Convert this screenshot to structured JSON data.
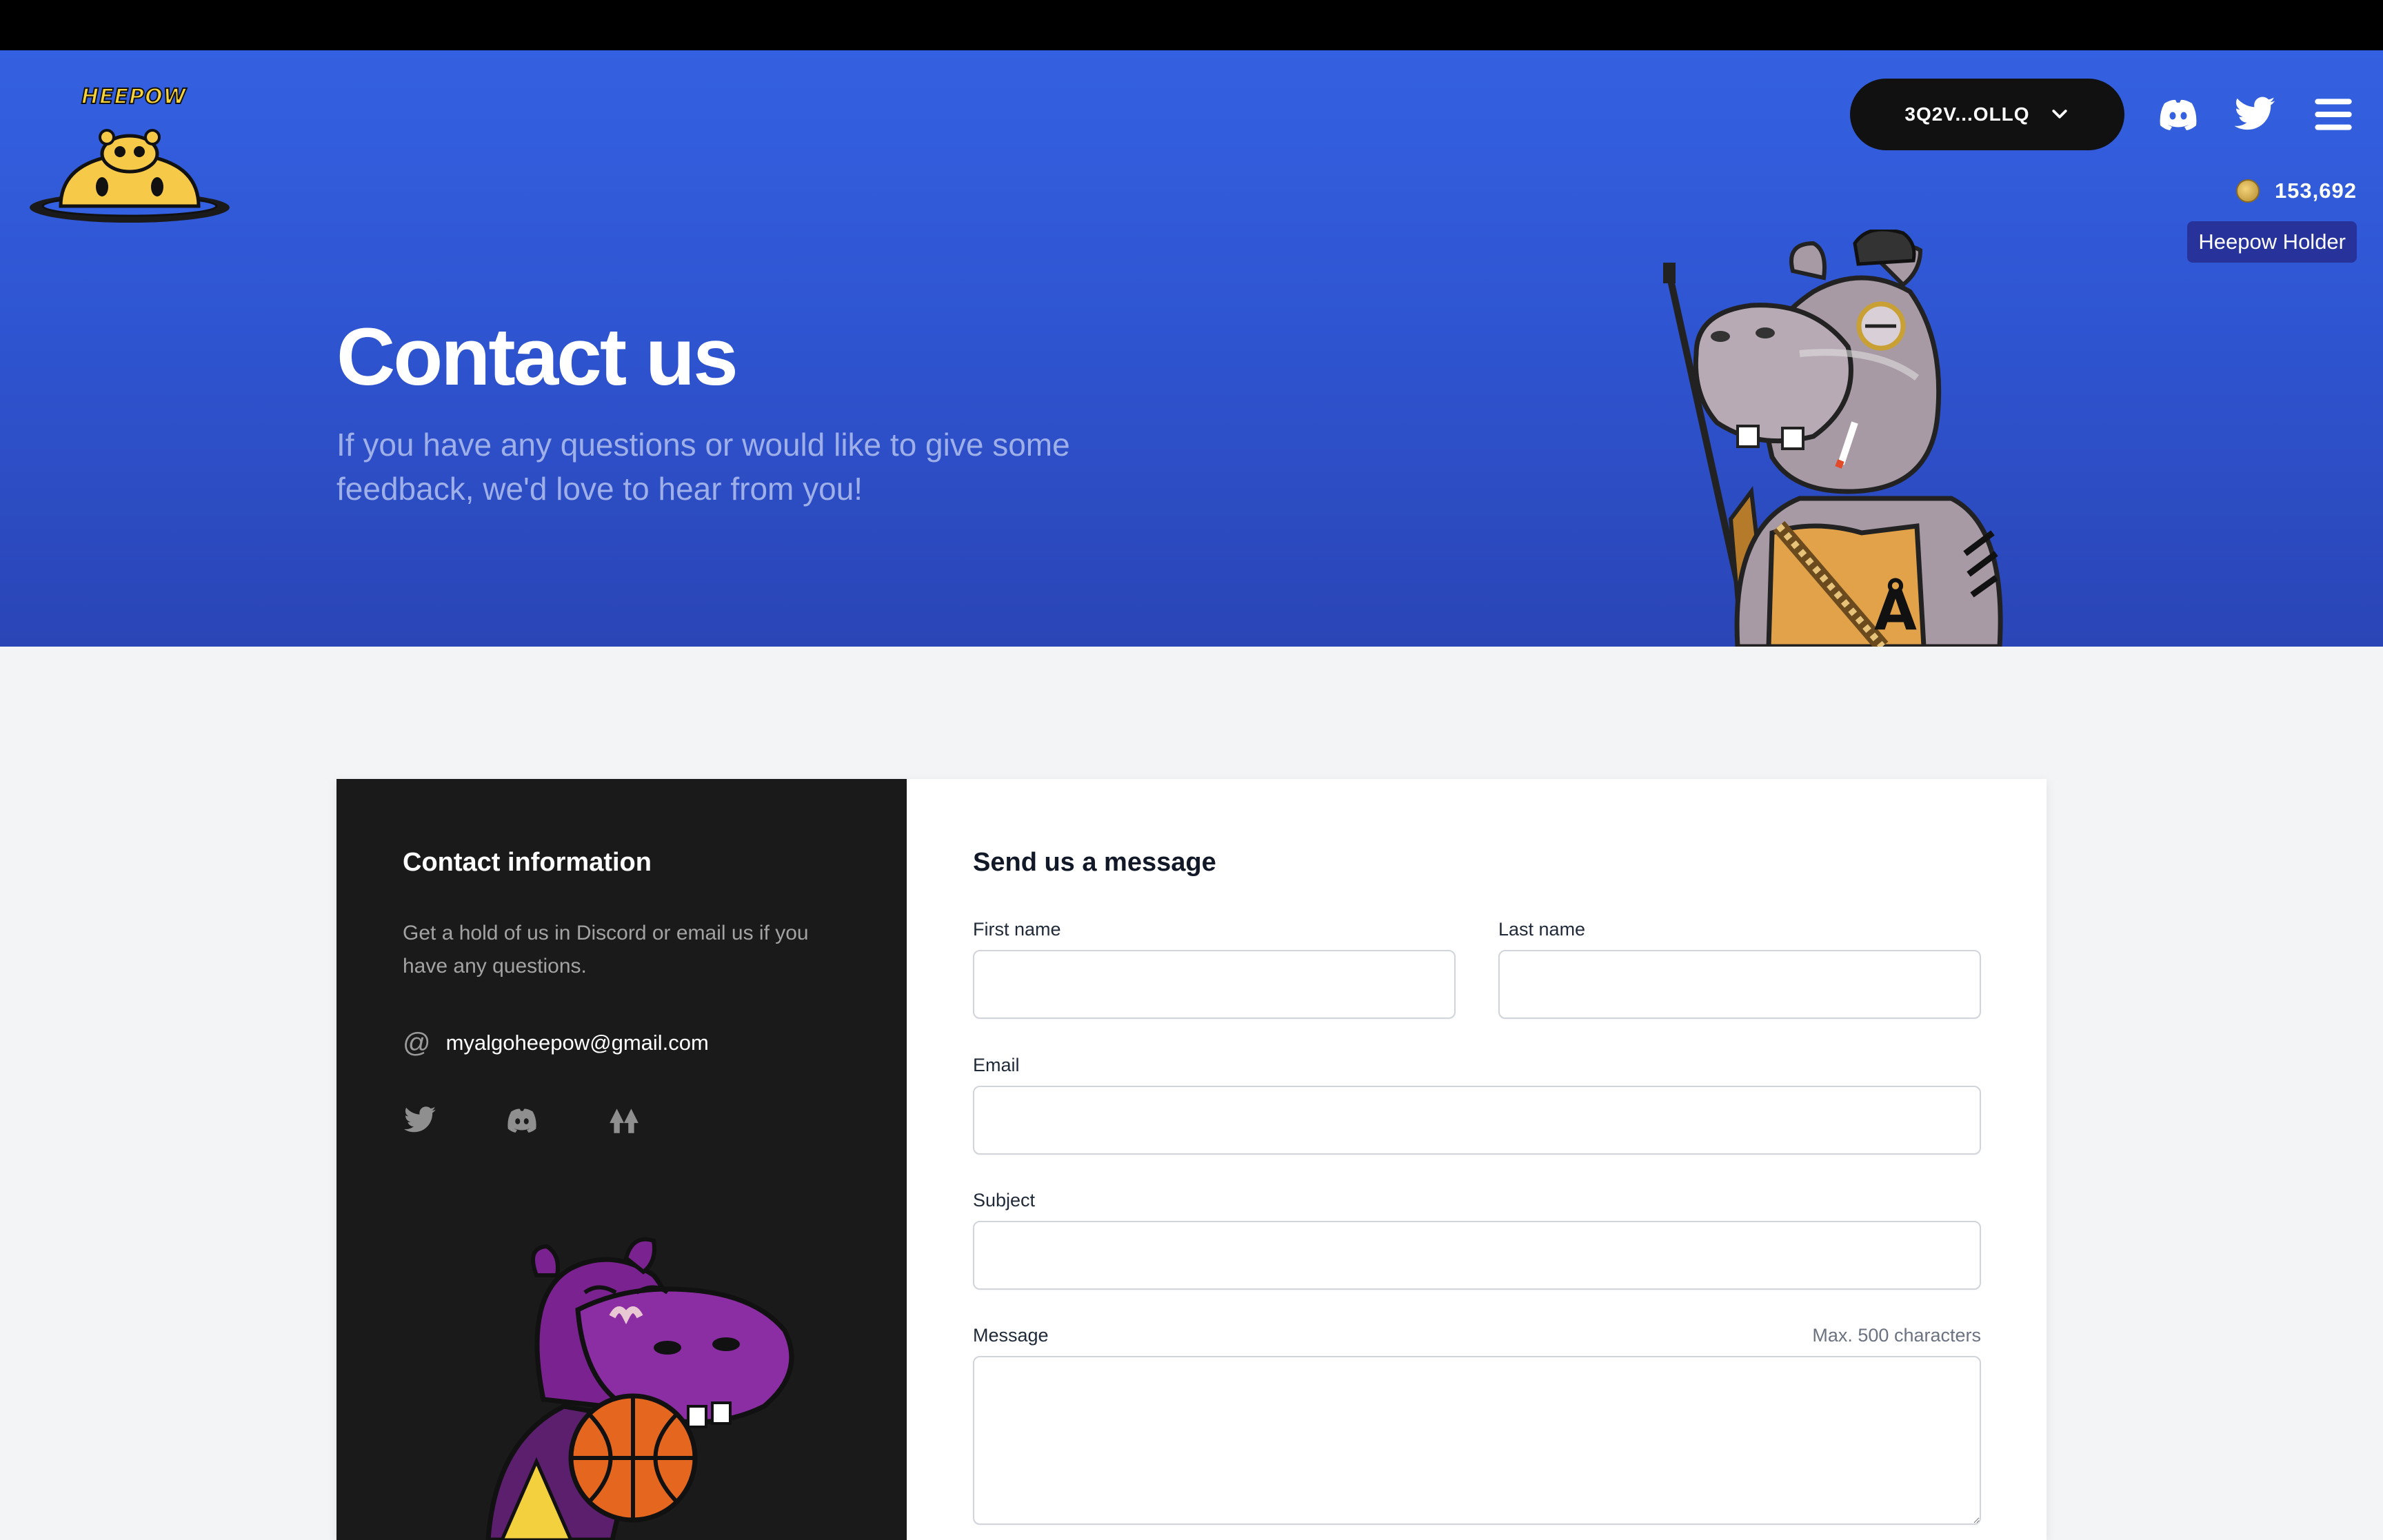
{
  "header": {
    "logo_text": "HEEPOW",
    "wallet_label": "3Q2V...OLLQ",
    "balance": "153,692",
    "holder_badge": "Heepow Holder",
    "icons": [
      "heepow-logo-icon",
      "chevron-down-icon",
      "discord-icon",
      "twitter-icon",
      "menu-icon",
      "coin-icon"
    ]
  },
  "hero": {
    "title": "Contact us",
    "subtitle": "If you have any questions or would like to give some feedback, we'd love to hear from you!"
  },
  "contact_info": {
    "title": "Contact information",
    "text": "Get a hold of us in Discord or email us if you have any questions.",
    "email": "myalgoheepow@gmail.com",
    "social_icons": [
      "twitter-icon",
      "discord-icon",
      "nft-marketplace-icon"
    ]
  },
  "form": {
    "title": "Send us a message",
    "first_name_label": "First name",
    "first_name_value": "",
    "last_name_label": "Last name",
    "last_name_value": "",
    "email_label": "Email",
    "email_value": "",
    "subject_label": "Subject",
    "subject_value": "",
    "message_label": "Message",
    "message_hint": "Max. 500 characters",
    "message_value": ""
  },
  "colors": {
    "hero_blue": "#3461e1",
    "panel_dark": "#1a1a1a",
    "badge_navy": "#27339a",
    "logo_yellow": "#f7d23a"
  }
}
